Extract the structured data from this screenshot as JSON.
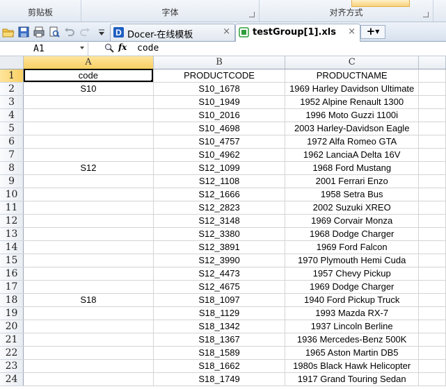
{
  "ribbon": {
    "groups": [
      {
        "label": "剪贴板"
      },
      {
        "label": "字体"
      },
      {
        "label": "对齐方式"
      }
    ]
  },
  "tabs": [
    {
      "label": "Docer-在线模板",
      "close": "×"
    },
    {
      "label": "testGroup[1].xls",
      "close": "×"
    }
  ],
  "new_tab": "+",
  "formula_bar": {
    "cell_ref": "A1",
    "content": "code",
    "fx_label": "fx"
  },
  "sheet": {
    "columns": [
      "A",
      "B",
      "C"
    ],
    "rows": [
      {
        "n": "1",
        "code": "code",
        "productcode": "PRODUCTCODE",
        "productname": "PRODUCTNAME"
      },
      {
        "n": "2",
        "code": "S10",
        "productcode": "S10_1678",
        "productname": "1969 Harley Davidson Ultimate"
      },
      {
        "n": "3",
        "code": "",
        "productcode": "S10_1949",
        "productname": "1952 Alpine Renault 1300"
      },
      {
        "n": "4",
        "code": "",
        "productcode": "S10_2016",
        "productname": "1996 Moto Guzzi 1100i"
      },
      {
        "n": "5",
        "code": "",
        "productcode": "S10_4698",
        "productname": "2003 Harley-Davidson Eagle"
      },
      {
        "n": "6",
        "code": "",
        "productcode": "S10_4757",
        "productname": "1972 Alfa Romeo GTA"
      },
      {
        "n": "7",
        "code": "",
        "productcode": "S10_4962",
        "productname": "1962 LanciaA Delta 16V"
      },
      {
        "n": "8",
        "code": "S12",
        "productcode": "S12_1099",
        "productname": "1968 Ford Mustang"
      },
      {
        "n": "9",
        "code": "",
        "productcode": "S12_1108",
        "productname": "2001 Ferrari Enzo"
      },
      {
        "n": "10",
        "code": "",
        "productcode": "S12_1666",
        "productname": "1958 Setra Bus"
      },
      {
        "n": "11",
        "code": "",
        "productcode": "S12_2823",
        "productname": "2002 Suzuki XREO"
      },
      {
        "n": "12",
        "code": "",
        "productcode": "S12_3148",
        "productname": "1969 Corvair Monza"
      },
      {
        "n": "13",
        "code": "",
        "productcode": "S12_3380",
        "productname": "1968 Dodge Charger"
      },
      {
        "n": "14",
        "code": "",
        "productcode": "S12_3891",
        "productname": "1969 Ford Falcon"
      },
      {
        "n": "15",
        "code": "",
        "productcode": "S12_3990",
        "productname": "1970 Plymouth Hemi Cuda"
      },
      {
        "n": "16",
        "code": "",
        "productcode": "S12_4473",
        "productname": "1957 Chevy Pickup"
      },
      {
        "n": "17",
        "code": "",
        "productcode": "S12_4675",
        "productname": "1969 Dodge Charger"
      },
      {
        "n": "18",
        "code": "S18",
        "productcode": "S18_1097",
        "productname": "1940 Ford Pickup Truck"
      },
      {
        "n": "19",
        "code": "",
        "productcode": "S18_1129",
        "productname": "1993 Mazda RX-7"
      },
      {
        "n": "20",
        "code": "",
        "productcode": "S18_1342",
        "productname": "1937 Lincoln Berline"
      },
      {
        "n": "21",
        "code": "",
        "productcode": "S18_1367",
        "productname": "1936 Mercedes-Benz 500K"
      },
      {
        "n": "22",
        "code": "",
        "productcode": "S18_1589",
        "productname": "1965 Aston Martin DB5"
      },
      {
        "n": "23",
        "code": "",
        "productcode": "S18_1662",
        "productname": "1980s Black Hawk Helicopter"
      },
      {
        "n": "24",
        "code": "",
        "productcode": "S18_1749",
        "productname": "1917 Grand Touring Sedan"
      }
    ]
  },
  "colors": {
    "selected_header": "#f8cf62",
    "header_bg": "#e9edf2",
    "gridline": "#d4d4d4"
  }
}
